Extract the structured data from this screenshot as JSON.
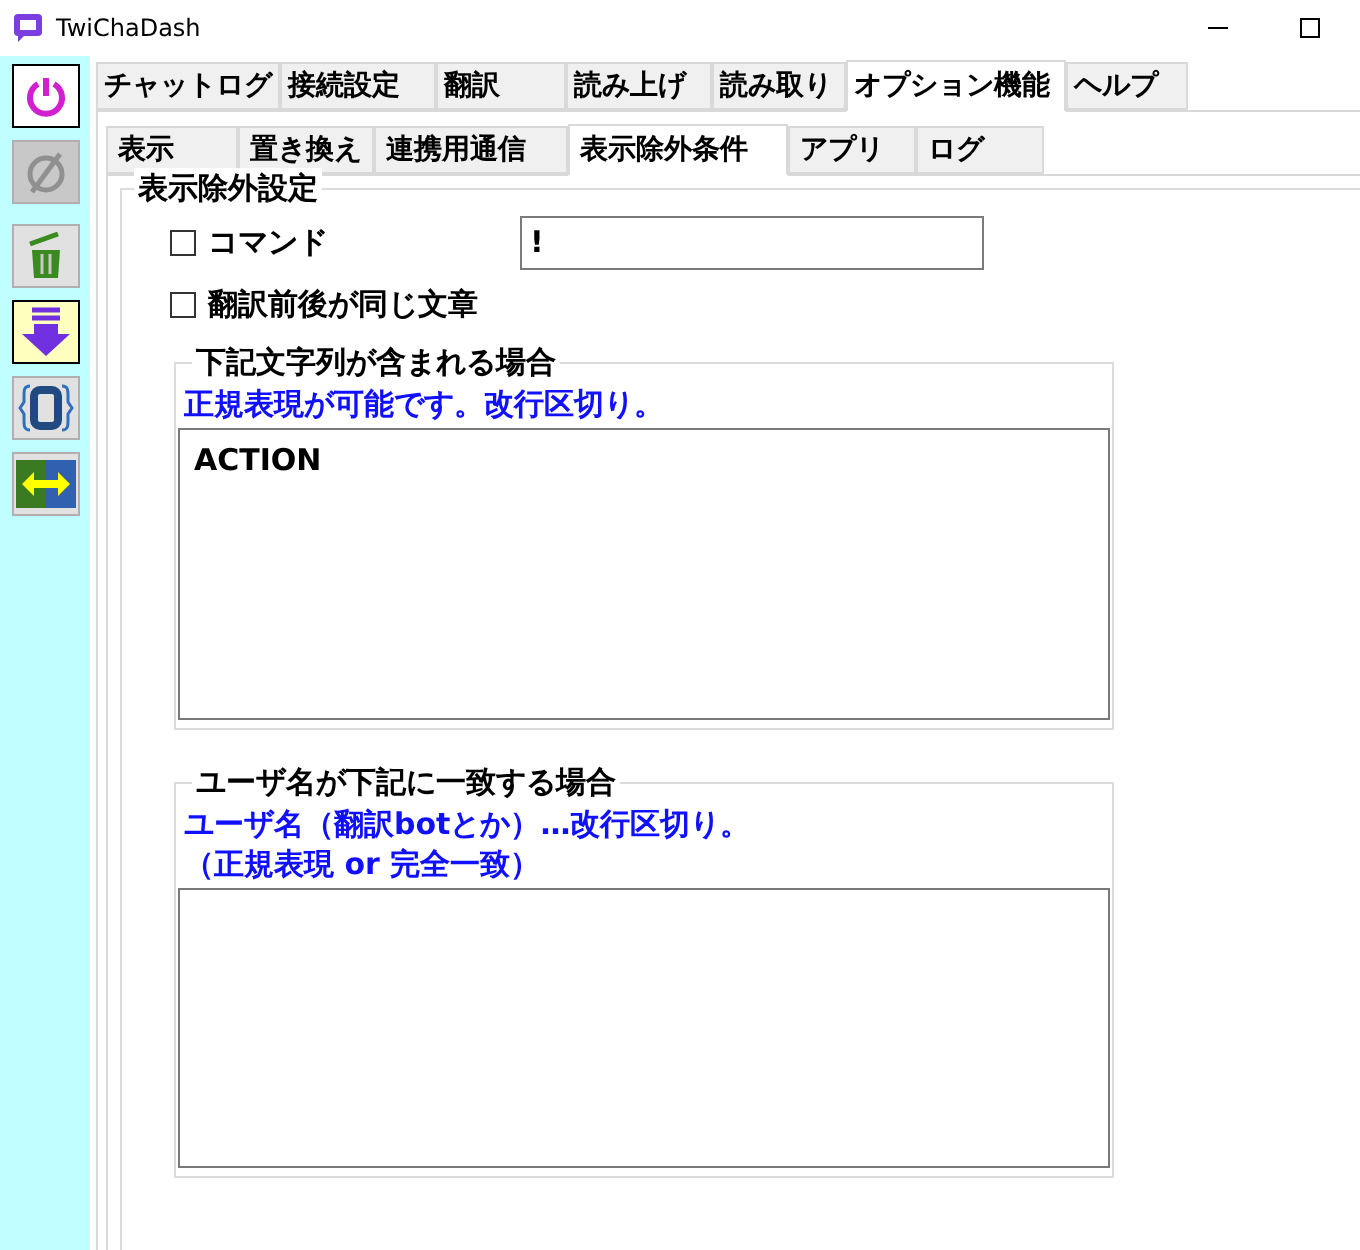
{
  "window": {
    "title": "TwiChaDash"
  },
  "sidebar": {
    "buttons": [
      {
        "kind": "power",
        "on": true,
        "disabled": false
      },
      {
        "kind": "unlink",
        "on": false,
        "disabled": true
      },
      {
        "kind": "trash",
        "on": false,
        "disabled": false
      },
      {
        "kind": "down",
        "on": true,
        "disabled": false
      },
      {
        "kind": "bracket",
        "on": false,
        "disabled": false
      },
      {
        "kind": "swap",
        "on": false,
        "disabled": false
      }
    ]
  },
  "tabs": [
    {
      "label": "チャットログ",
      "selected": false
    },
    {
      "label": "接続設定",
      "selected": false
    },
    {
      "label": "翻訳",
      "selected": false
    },
    {
      "label": "読み上げ",
      "selected": false
    },
    {
      "label": "読み取り",
      "selected": false
    },
    {
      "label": "オプション機能",
      "selected": true
    },
    {
      "label": "ヘルプ",
      "selected": false
    }
  ],
  "subtabs": [
    {
      "label": "表示",
      "selected": false
    },
    {
      "label": "置き換え",
      "selected": false
    },
    {
      "label": "連携用通信",
      "selected": false
    },
    {
      "label": "表示除外条件",
      "selected": true
    },
    {
      "label": "アプリ",
      "selected": false
    },
    {
      "label": "ログ",
      "selected": false
    }
  ],
  "group": {
    "title": "表示除外設定",
    "command": {
      "label": "コマンド",
      "checked": false,
      "value": "!"
    },
    "same_text": {
      "label": "翻訳前後が同じ文章",
      "checked": false
    },
    "contains": {
      "title": "下記文字列が含まれる場合",
      "note": [
        "正規表現が可能です。改行区切り。"
      ],
      "value": "ACTION"
    },
    "username": {
      "title": "ユーザ名が下記に一致する場合",
      "note": [
        "ユーザ名（翻訳botとか）…改行区切り。",
        "（正規表現 or 完全一致）"
      ]
    }
  }
}
